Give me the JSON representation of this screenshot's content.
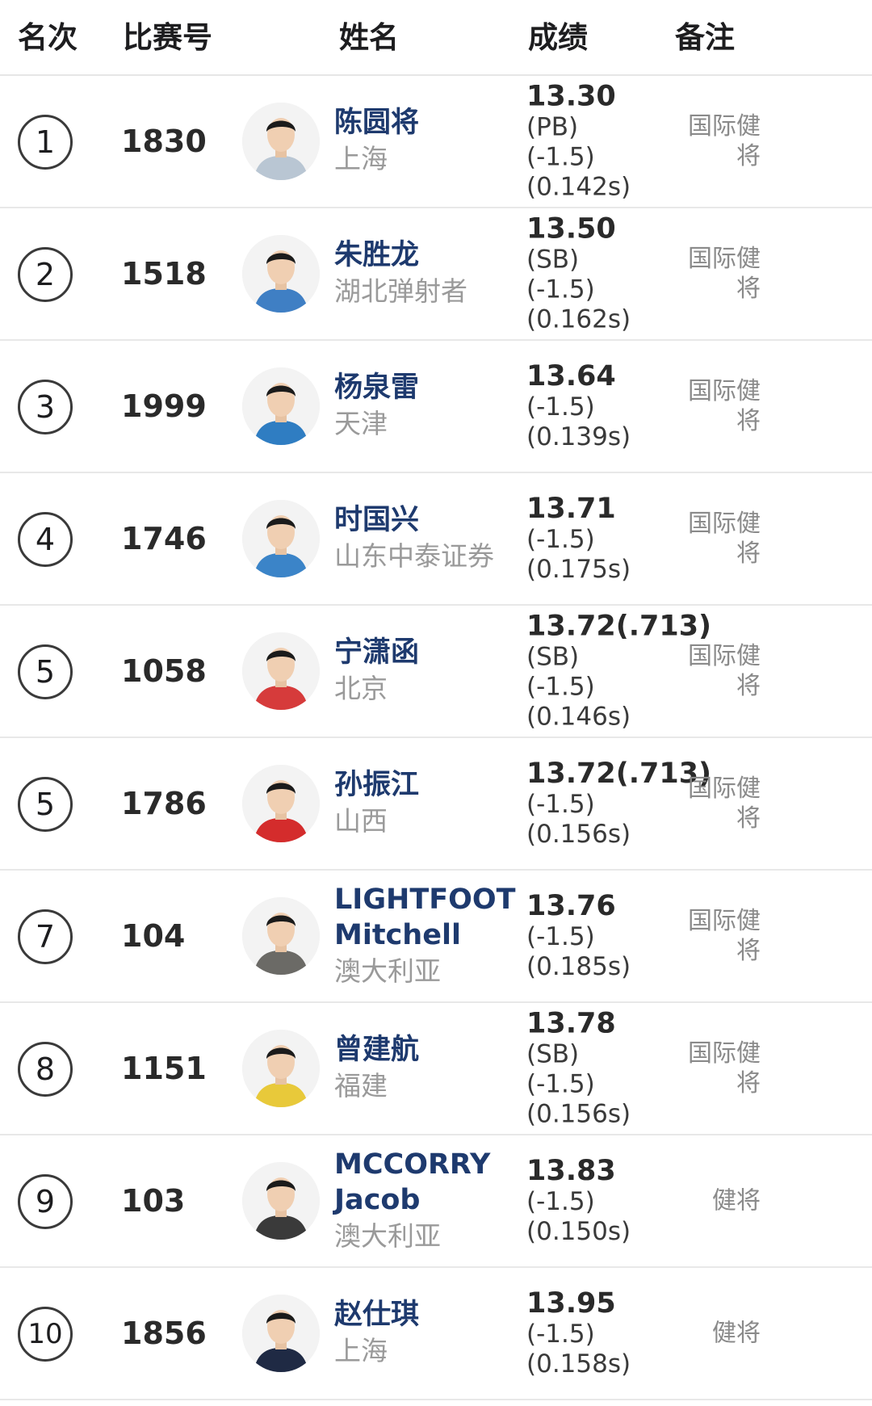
{
  "headers": {
    "rank": "名次",
    "bib": "比赛号",
    "name": "姓名",
    "result": "成绩",
    "note": "备注"
  },
  "rows": [
    {
      "rank": "1",
      "bib": "1830",
      "name": "陈圆将",
      "team": "上海",
      "mark": "13.30",
      "lines": [
        "(PB)",
        "(-1.5)",
        "(0.142s)"
      ],
      "note": "国际健将",
      "avatar_color": "#b9c6d3"
    },
    {
      "rank": "2",
      "bib": "1518",
      "name": "朱胜龙",
      "team": "湖北弹射者",
      "mark": "13.50",
      "lines": [
        "(SB)",
        "(-1.5)",
        "(0.162s)"
      ],
      "note": "国际健将",
      "avatar_color": "#3f7fc4"
    },
    {
      "rank": "3",
      "bib": "1999",
      "name": "杨泉雷",
      "team": "天津",
      "mark": "13.64",
      "lines": [
        "(-1.5)",
        "(0.139s)"
      ],
      "note": "国际健将",
      "avatar_color": "#2f7dc2"
    },
    {
      "rank": "4",
      "bib": "1746",
      "name": "时国兴",
      "team": "山东中泰证券",
      "mark": "13.71",
      "lines": [
        "(-1.5)",
        "(0.175s)"
      ],
      "note": "国际健将",
      "avatar_color": "#3b84c8"
    },
    {
      "rank": "5",
      "bib": "1058",
      "name": "宁潇函",
      "team": "北京",
      "mark": "13.72(.713)",
      "lines": [
        "(SB)",
        "(-1.5)",
        "(0.146s)"
      ],
      "note": "国际健将",
      "avatar_color": "#d63b3b"
    },
    {
      "rank": "5",
      "bib": "1786",
      "name": "孙振江",
      "team": "山西",
      "mark": "13.72(.713)",
      "lines": [
        "(-1.5)",
        "(0.156s)"
      ],
      "note": "国际健将",
      "avatar_color": "#d42c2c"
    },
    {
      "rank": "7",
      "bib": "104",
      "name": "LIGHTFOOT Mitchell",
      "team": "澳大利亚",
      "mark": "13.76",
      "lines": [
        "(-1.5)",
        "(0.185s)"
      ],
      "note": "国际健将",
      "avatar_color": "#6b6a66"
    },
    {
      "rank": "8",
      "bib": "1151",
      "name": "曾建航",
      "team": "福建",
      "mark": "13.78",
      "lines": [
        "(SB)",
        "(-1.5)",
        "(0.156s)"
      ],
      "note": "国际健将",
      "avatar_color": "#e8c93a"
    },
    {
      "rank": "9",
      "bib": "103",
      "name": "MCCORRY Jacob",
      "team": "澳大利亚",
      "mark": "13.83",
      "lines": [
        "(-1.5)",
        "(0.150s)"
      ],
      "note": "健将",
      "avatar_color": "#3a3a3a"
    },
    {
      "rank": "10",
      "bib": "1856",
      "name": "赵仕琪",
      "team": "上海",
      "mark": "13.95",
      "lines": [
        "(-1.5)",
        "(0.158s)"
      ],
      "note": "健将",
      "avatar_color": "#1f2a44"
    }
  ]
}
